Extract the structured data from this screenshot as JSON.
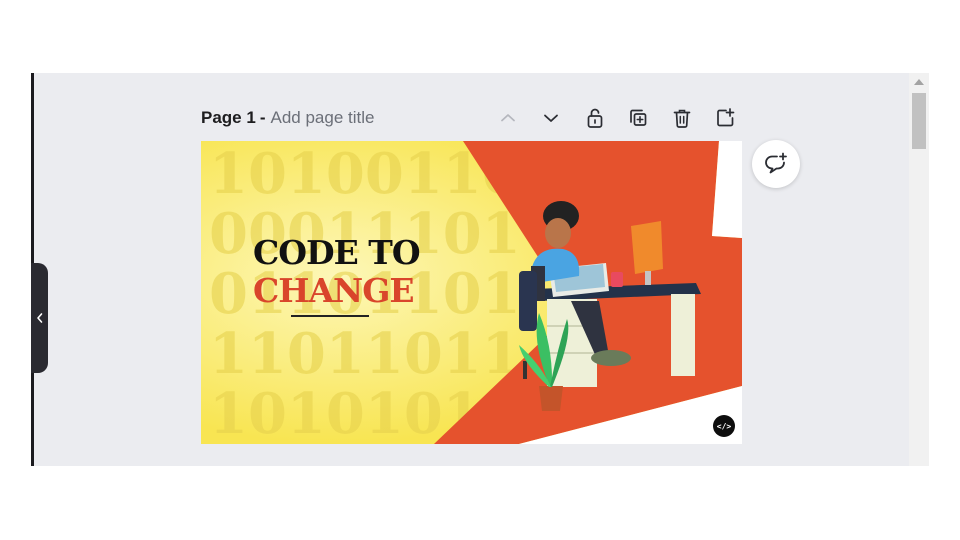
{
  "page": {
    "label": "Page 1",
    "separator": "-",
    "title_placeholder": "Add page title"
  },
  "toolbar": {
    "icons": [
      "chevron-up-icon",
      "chevron-down-icon",
      "unlock-icon",
      "duplicate-icon",
      "trash-icon",
      "add-page-icon"
    ]
  },
  "design": {
    "headline_line1": "CODE TO",
    "headline_line2": "CHANGE",
    "code_badge": "</>",
    "binary_rows": [
      "10100110",
      "00011101",
      "01101101",
      "11011011",
      "10101011"
    ],
    "colors": {
      "yellow": "#f9ea63",
      "orange": "#e5522d",
      "headline": "#111111",
      "accent": "#d9452b"
    }
  },
  "comment_button": {
    "icon": "add-comment-icon"
  }
}
